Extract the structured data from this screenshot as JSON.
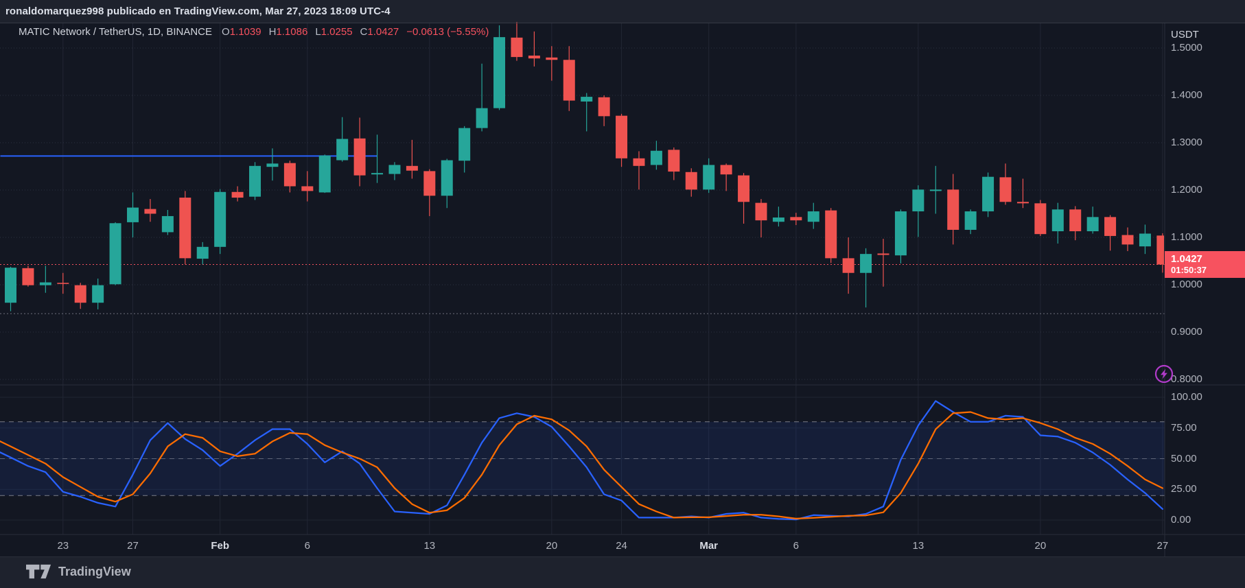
{
  "header": {
    "share_text": "ronaldomarquez998 publicado en TradingView.com, Mar 27, 2023 18:09 UTC-4"
  },
  "legend": {
    "symbol_title": "MATIC Network / TetherUS, 1D, BINANCE",
    "open_label": "O",
    "open_value": "1.1039",
    "high_label": "H",
    "high_value": "1.1086",
    "low_label": "L",
    "low_value": "1.0255",
    "close_label": "C",
    "close_value": "1.0427",
    "change_text": "−0.0613 (−5.55%)"
  },
  "price_scale": {
    "currency_label": "USDT",
    "ticks": [
      {
        "label": "1.5000",
        "value": 1.5
      },
      {
        "label": "1.4000",
        "value": 1.4
      },
      {
        "label": "1.3000",
        "value": 1.3
      },
      {
        "label": "1.2000",
        "value": 1.2
      },
      {
        "label": "1.1000",
        "value": 1.1
      },
      {
        "label": "1.0000",
        "value": 1.0
      },
      {
        "label": "0.9000",
        "value": 0.9
      },
      {
        "label": "0.8000",
        "value": 0.8
      }
    ],
    "last_price_label": {
      "price": "1.0427",
      "countdown": "01:50:37"
    }
  },
  "indicator_scale": {
    "ticks": [
      {
        "label": "100.00",
        "value": 100
      },
      {
        "label": "75.00",
        "value": 75
      },
      {
        "label": "50.00",
        "value": 50
      },
      {
        "label": "25.00",
        "value": 25
      },
      {
        "label": "0.00",
        "value": 0
      }
    ]
  },
  "time_scale": {
    "ticks": [
      {
        "label": "23",
        "index": 3,
        "bold": false
      },
      {
        "label": "27",
        "index": 7,
        "bold": false
      },
      {
        "label": "Feb",
        "index": 12,
        "bold": true
      },
      {
        "label": "6",
        "index": 17,
        "bold": false
      },
      {
        "label": "13",
        "index": 24,
        "bold": false
      },
      {
        "label": "20",
        "index": 31,
        "bold": false
      },
      {
        "label": "24",
        "index": 35,
        "bold": false
      },
      {
        "label": "Mar",
        "index": 40,
        "bold": true
      },
      {
        "label": "6",
        "index": 45,
        "bold": false
      },
      {
        "label": "13",
        "index": 52,
        "bold": false
      },
      {
        "label": "20",
        "index": 59,
        "bold": false
      },
      {
        "label": "27",
        "index": 66,
        "bold": false
      }
    ]
  },
  "footer": {
    "logo_text": "TradingView"
  },
  "colors": {
    "bg_outer": "#1e222d",
    "bg_chart": "#131722",
    "border": "#2a2e39",
    "header_separator": "#363a45",
    "grid_vertical": "#222634",
    "grid_dotted": "#2b3040",
    "grid_stoch": "#1f2431",
    "text_primary": "#d1d4dc",
    "text_secondary": "#b2b5be",
    "candle_up": "#26a69a",
    "candle_down": "#ef5350",
    "accent_red": "#f7525f",
    "stoch_k_blue": "#2962ff",
    "stoch_d_orange": "#ff6d00",
    "band_fill": "rgba(41,98,255,0.10)",
    "band_dashed_line": "#9598a1",
    "ray_blue": "#2962ff",
    "dotted_grey": "#787b86",
    "icon_purple": "#b23bcb",
    "label_text_white": "#ffffff"
  },
  "chart_data": {
    "type": "candlestick+stochastic",
    "title": "MATIC Network / TetherUS, 1D, BINANCE",
    "price_axis_range": [
      0.76,
      1.57
    ],
    "indicator_axis_range": [
      0,
      100
    ],
    "ohlc_order": "o,h,l,c",
    "candles": [
      [
        0.962,
        1.038,
        0.944,
        1.036
      ],
      [
        1.035,
        1.04,
        0.996,
        0.999
      ],
      [
        0.999,
        1.04,
        0.983,
        1.005
      ],
      [
        1.004,
        1.025,
        0.981,
        1.002
      ],
      [
        0.999,
        1.004,
        0.949,
        0.962
      ],
      [
        0.962,
        1.013,
        0.948,
        0.999
      ],
      [
        1.001,
        1.132,
        0.999,
        1.13
      ],
      [
        1.132,
        1.195,
        1.1,
        1.163
      ],
      [
        1.16,
        1.181,
        1.133,
        1.15
      ],
      [
        1.111,
        1.158,
        1.105,
        1.145
      ],
      [
        1.184,
        1.198,
        1.043,
        1.056
      ],
      [
        1.055,
        1.09,
        1.043,
        1.08
      ],
      [
        1.08,
        1.202,
        1.065,
        1.196
      ],
      [
        1.196,
        1.208,
        1.176,
        1.184
      ],
      [
        1.186,
        1.259,
        1.179,
        1.251
      ],
      [
        1.249,
        1.288,
        1.22,
        1.256
      ],
      [
        1.257,
        1.262,
        1.195,
        1.208
      ],
      [
        1.208,
        1.24,
        1.176,
        1.198
      ],
      [
        1.195,
        1.275,
        1.194,
        1.273
      ],
      [
        1.263,
        1.354,
        1.26,
        1.308
      ],
      [
        1.309,
        1.353,
        1.208,
        1.231
      ],
      [
        1.233,
        1.317,
        1.215,
        1.236
      ],
      [
        1.234,
        1.259,
        1.221,
        1.253
      ],
      [
        1.251,
        1.306,
        1.224,
        1.241
      ],
      [
        1.24,
        1.244,
        1.145,
        1.188
      ],
      [
        1.188,
        1.266,
        1.162,
        1.263
      ],
      [
        1.262,
        1.335,
        1.237,
        1.331
      ],
      [
        1.331,
        1.467,
        1.324,
        1.373
      ],
      [
        1.373,
        1.548,
        1.369,
        1.523
      ],
      [
        1.522,
        1.555,
        1.473,
        1.481
      ],
      [
        1.484,
        1.535,
        1.461,
        1.478
      ],
      [
        1.48,
        1.504,
        1.431,
        1.475
      ],
      [
        1.475,
        1.504,
        1.367,
        1.389
      ],
      [
        1.387,
        1.405,
        1.324,
        1.397
      ],
      [
        1.396,
        1.4,
        1.335,
        1.356
      ],
      [
        1.357,
        1.361,
        1.249,
        1.267
      ],
      [
        1.267,
        1.282,
        1.201,
        1.251
      ],
      [
        1.253,
        1.304,
        1.243,
        1.283
      ],
      [
        1.285,
        1.29,
        1.221,
        1.239
      ],
      [
        1.238,
        1.246,
        1.186,
        1.201
      ],
      [
        1.201,
        1.267,
        1.194,
        1.253
      ],
      [
        1.253,
        1.256,
        1.198,
        1.233
      ],
      [
        1.231,
        1.236,
        1.129,
        1.175
      ],
      [
        1.173,
        1.181,
        1.1,
        1.136
      ],
      [
        1.133,
        1.165,
        1.123,
        1.142
      ],
      [
        1.143,
        1.152,
        1.126,
        1.136
      ],
      [
        1.133,
        1.173,
        1.118,
        1.155
      ],
      [
        1.157,
        1.162,
        1.046,
        1.056
      ],
      [
        1.056,
        1.1,
        0.981,
        1.025
      ],
      [
        1.025,
        1.077,
        0.952,
        1.065
      ],
      [
        1.066,
        1.097,
        0.996,
        1.063
      ],
      [
        1.062,
        1.159,
        1.045,
        1.155
      ],
      [
        1.155,
        1.21,
        1.101,
        1.201
      ],
      [
        1.198,
        1.251,
        1.15,
        1.201
      ],
      [
        1.201,
        1.234,
        1.085,
        1.116
      ],
      [
        1.116,
        1.159,
        1.107,
        1.155
      ],
      [
        1.155,
        1.237,
        1.143,
        1.228
      ],
      [
        1.227,
        1.256,
        1.169,
        1.175
      ],
      [
        1.175,
        1.224,
        1.162,
        1.172
      ],
      [
        1.172,
        1.179,
        1.103,
        1.107
      ],
      [
        1.113,
        1.173,
        1.087,
        1.159
      ],
      [
        1.159,
        1.166,
        1.094,
        1.113
      ],
      [
        1.113,
        1.165,
        1.108,
        1.143
      ],
      [
        1.143,
        1.147,
        1.072,
        1.103
      ],
      [
        1.105,
        1.121,
        1.071,
        1.085
      ],
      [
        1.081,
        1.127,
        1.065,
        1.108
      ],
      [
        1.1039,
        1.1086,
        1.0255,
        1.0427
      ]
    ],
    "stochastic": {
      "k_color_name": "blue",
      "d_color_name": "orange",
      "upper_band": 80,
      "middle_band": 50,
      "lower_band": 20,
      "k": [
        51,
        44,
        39,
        23,
        19,
        14,
        11,
        37,
        65,
        79,
        66,
        57,
        44,
        54,
        65,
        74,
        74,
        62,
        47,
        56,
        46,
        26,
        7,
        6,
        5,
        12,
        37,
        63,
        83,
        87,
        84,
        76,
        60,
        43,
        21,
        16,
        2,
        2,
        2,
        3,
        2,
        5,
        6,
        2,
        1,
        0.5,
        4,
        3.5,
        3,
        5,
        11,
        49,
        77,
        97,
        88,
        80,
        80,
        85,
        84,
        69,
        68,
        63,
        55,
        45,
        33,
        22,
        9
      ],
      "d": [
        60,
        53,
        46,
        35,
        27,
        19,
        15,
        21,
        38,
        60,
        70,
        67,
        56,
        52,
        54,
        64,
        71,
        70,
        61,
        55,
        50,
        43,
        26,
        13,
        6,
        8,
        18,
        37,
        61,
        78,
        85,
        82,
        73,
        60,
        41,
        27,
        13,
        7,
        2,
        2.3,
        2.3,
        3.3,
        4.3,
        4.3,
        3,
        1.2,
        1.8,
        2.7,
        3.5,
        3.8,
        6.3,
        22,
        46,
        74,
        87,
        88,
        83,
        82,
        83,
        79,
        74,
        67,
        62,
        54,
        44,
        33,
        26
      ]
    },
    "drawings": {
      "blue_horizontal_ray": {
        "price": 1.272,
        "from_index": 0,
        "to_index": 21
      },
      "current_price_dotted_line": {
        "price": 1.0427
      },
      "grey_dotted_line": {
        "price": 0.939
      }
    }
  }
}
